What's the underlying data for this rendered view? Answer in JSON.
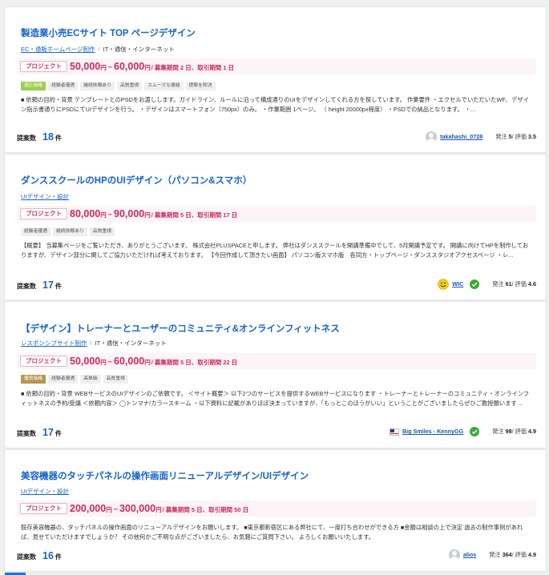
{
  "jobs": [
    {
      "title": "製造業小売ECサイト TOP ページデザイン",
      "cat1": "EC・通販ホームページ制作",
      "cat2": "IT・通信・インターネット",
      "price_tag": "プロジェクト",
      "price_min": "50,000",
      "price_max": "60,000",
      "price_unit": "円",
      "period": "/ 募集期間 2 日、取引期間 1 日",
      "tags": [
        "適正価格",
        "経験者優遇",
        "継続依頼あり",
        "品質重視",
        "スムーズな連絡",
        "提案を即決"
      ],
      "description": "■ 依頼の目的・背景 テンプレートとのPSDをお渡しします。ガイドライン、ルールに沿って構成通りのUIをデザインしてくれる方を探しています。 作業要件 ・エクセルでいただいたWF、デザイン指示書通りにPSDにてUIデザインを行う。 ・デザインはスマートフォン（750px）のみ。 ・作業範囲 1ページ。 （ height 20000px程度） ・PSDでの納品となります。 ・...",
      "count_label": "提案数",
      "count": "18",
      "count_unit": "件",
      "client": "takahashi_0728",
      "stats_label": "発注",
      "orders": "5",
      "rating_label": "/ 評価",
      "rating": "3.5"
    },
    {
      "title": "ダンススクールのHPのUIデザイン（パソコン&スマホ）",
      "cat1": "UIデザイン・設計",
      "price_tag": "プロジェクト",
      "price_min": "80,000",
      "price_max": "90,000",
      "price_unit": "円",
      "period": "/ 募集期間 5 日、取引期間 17 日",
      "tags": [
        "経験者優遇",
        "継続依頼あり",
        "品質重視"
      ],
      "description": "【概要】 当募集ページをご覧いただき、ありがとうございます。 株式会社PLUSPACEと申します。 弊社はダンススクールを開講準備中でして、5月開講予定です。 開講に向けてHPを制作しておりますが、デザイン部分に関してご協力いただければ考えております。 【今回作成して頂きたい画面】 パソコン版スマホ版　各同方・トップページ・ダンススタジオアクセスページ ・レ...",
      "count_label": "提案数",
      "count": "17",
      "count_unit": "件",
      "client": "WIC",
      "stats_label": "発注",
      "orders": "61",
      "rating_label": "/ 評価",
      "rating": "4.6"
    },
    {
      "title": "【デザイン】トレーナーとユーザーのコミュニティ&オンラインフィットネス",
      "cat1": "レスポンシブサイト制作",
      "cat2": "IT・通信・インターネット",
      "price_tag": "プロジェクト",
      "price_min": "50,000",
      "price_max": "60,000",
      "price_unit": "円",
      "period": "/ 募集期間 5 日、取引期間 22 日",
      "tags": [
        "優良価格",
        "経験者優遇",
        "高単価",
        "品質重視"
      ],
      "description": "■ 依頼の目的・背景 WEBサービスのUIデザインのご依頼です。 ＜サイト概要＞ 以下2つのサービスを提供するWEBサービスになります ・トレーナーとトレーナーのコミュニティ・オンラインフィットネスの予約/受講 ＜依頼内容＞ ◯トンマナ/カラースキーム ・以下資料に記載がありほぼ決まっていますが、「もっとこのほうがいい」ということがございましたらぜひご教授願います ...",
      "count_label": "提案数",
      "count": "17",
      "count_unit": "件",
      "client": "Big Smiles - KennyGG",
      "stats_label": "発注",
      "orders": "98",
      "rating_label": "/ 評価",
      "rating": "4.9"
    },
    {
      "title": "美容機器のタッチパネルの操作画面リニューアルデザイン/UIデザイン",
      "cat1": "UIデザイン・設計",
      "price_tag": "プロジェクト",
      "price_min": "200,000",
      "price_max": "300,000",
      "price_unit": "円",
      "period": "/ 募集期間 5 日、取引期間 50 日",
      "description": "既存美容機器の、タッチパネルの操作画面のリニューアルデザインをお願いします。 ■東京都新宿区にある弊社にて、一度打ち合わせができる方 ■金額は相談の上で決定 過去の制作事例があれば、見せていただけますでしょうか？ その他何かご不明な点がございましたら、お気軽にご質問下さい。 よろしくお願いいたします。",
      "count_label": "提案数",
      "count": "16",
      "count_unit": "件",
      "client": "alios",
      "stats_label": "発注",
      "orders": "364",
      "rating_label": "/ 評価",
      "rating": "4.9"
    }
  ],
  "colors": {
    "link": "#1a63c9",
    "price": "#cd2a5f",
    "verified": "#3aa935"
  }
}
